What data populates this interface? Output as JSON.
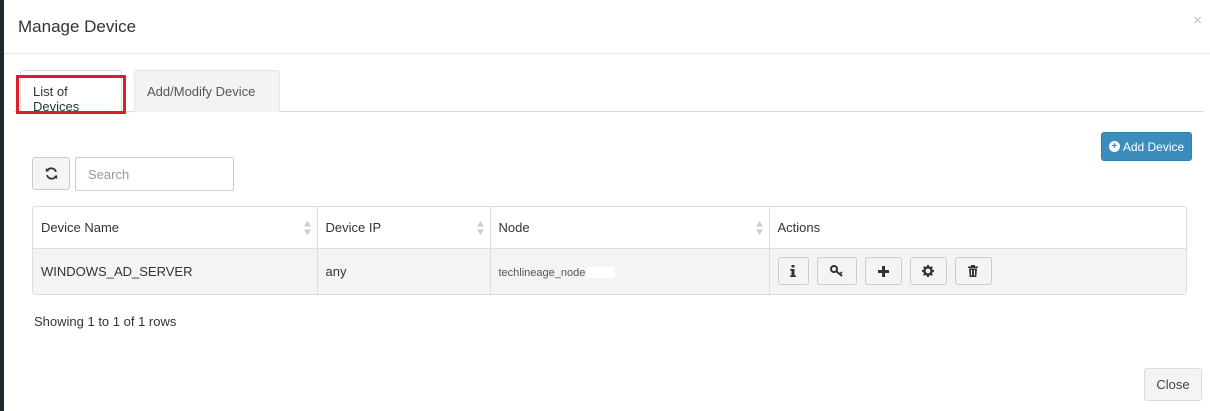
{
  "modal": {
    "title": "Manage Device",
    "close_icon": "×"
  },
  "tabs": [
    {
      "label": "List of Devices",
      "active": true
    },
    {
      "label": "Add/Modify Device",
      "active": false
    }
  ],
  "toolbar": {
    "add_label": "Add Device",
    "search_placeholder": "Search"
  },
  "table": {
    "columns": [
      "Device Name",
      "Device IP",
      "Node",
      "Actions"
    ],
    "rows": [
      {
        "device_name": "WINDOWS_AD_SERVER",
        "device_ip": "any",
        "node": "techlineage_node"
      }
    ],
    "action_icons": [
      "info-icon",
      "key-icon",
      "plus-icon",
      "gear-icon",
      "trash-icon"
    ]
  },
  "pagination": {
    "summary": "Showing 1 to 1 of 1 rows"
  },
  "footer": {
    "close_label": "Close"
  },
  "colors": {
    "primary": "#3c8dbc",
    "highlight": "#d8202a"
  }
}
